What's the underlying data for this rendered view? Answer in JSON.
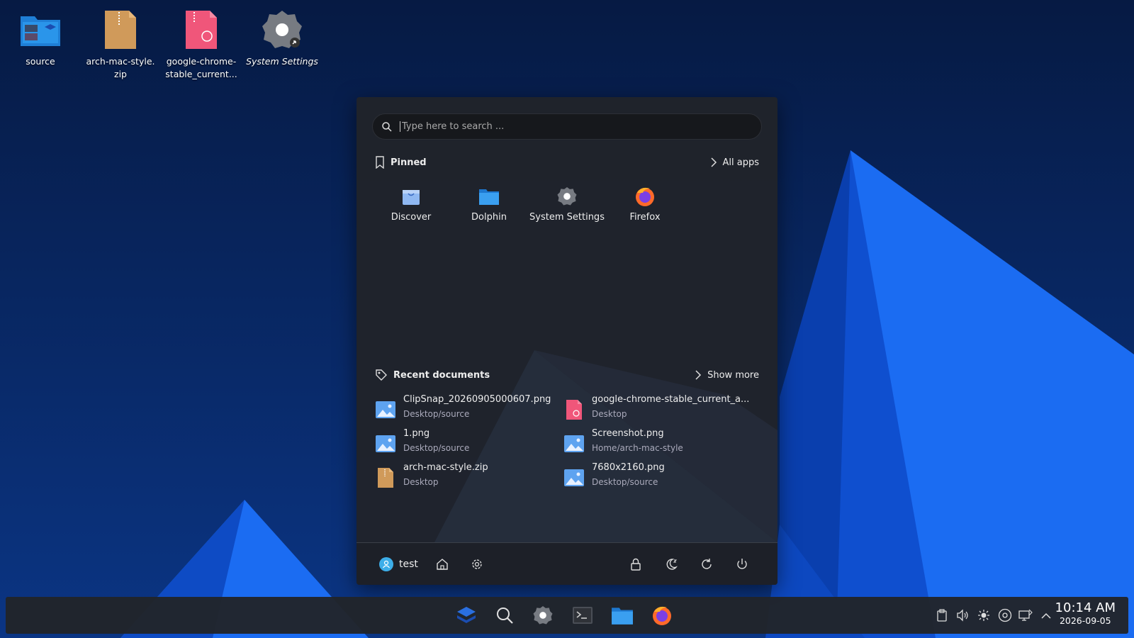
{
  "desktop": {
    "icons": [
      {
        "label": "source"
      },
      {
        "label": "arch-mac-style.\nzip"
      },
      {
        "label": "google-chrome-\nstable_current..."
      },
      {
        "label": "System Settings"
      }
    ]
  },
  "menu": {
    "search": {
      "placeholder": "Type here to search ..."
    },
    "pinned": {
      "title": "Pinned",
      "all_apps": "All apps",
      "apps": [
        {
          "label": "Discover",
          "icon": "discover-icon"
        },
        {
          "label": "Dolphin",
          "icon": "folder-icon"
        },
        {
          "label": "System Settings",
          "icon": "gear-icon"
        },
        {
          "label": "Firefox",
          "icon": "firefox-icon"
        }
      ]
    },
    "recent": {
      "title": "Recent documents",
      "show_more": "Show more",
      "docs": [
        {
          "name": "ClipSnap_20260905000607.png",
          "path": "Desktop/source",
          "icon": "image-icon"
        },
        {
          "name": "google-chrome-stable_current_a...",
          "path": "Desktop",
          "icon": "package-icon"
        },
        {
          "name": "1.png",
          "path": "Desktop/source",
          "icon": "image-icon"
        },
        {
          "name": "Screenshot.png",
          "path": "Home/arch-mac-style",
          "icon": "image-icon"
        },
        {
          "name": "arch-mac-style.zip",
          "path": "Desktop",
          "icon": "archive-icon"
        },
        {
          "name": "7680x2160.png",
          "path": "Desktop/source",
          "icon": "image-icon"
        }
      ]
    },
    "footer": {
      "user": "test"
    }
  },
  "taskbar": {
    "clock": {
      "time": "10:14 AM",
      "date": "2026-09-05"
    }
  },
  "colors": {
    "accent": "#3daee9",
    "wallpaper_blue": "#1565e8",
    "panel": "#21242a"
  }
}
